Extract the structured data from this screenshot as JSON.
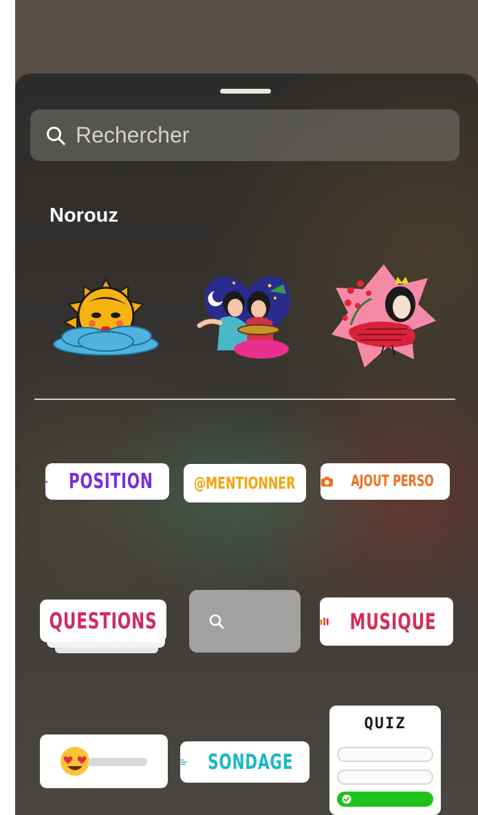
{
  "search": {
    "placeholder": "Rechercher"
  },
  "section": {
    "title": "Norouz"
  },
  "stickers": [
    {
      "name": "sun-in-clouds"
    },
    {
      "name": "musician-couple"
    },
    {
      "name": "woman-with-bird"
    }
  ],
  "chips": {
    "position": "POSITION",
    "mention": "@MENTIONNER",
    "ajout_perso": "AJOUT PERSO",
    "questions": "QUESTIONS",
    "musique": "MUSIQUE",
    "sondage": "SONDAGE",
    "quiz": "QUIZ"
  },
  "icons": {
    "search": "search-icon",
    "location": "location-pin-icon",
    "camera": "camera-icon",
    "music": "music-bars-icon",
    "poll": "poll-lines-icon",
    "emoji": "heart-eyes-emoji-icon",
    "check": "check-icon"
  },
  "colors": {
    "position": "#7b2fd6",
    "mention": "#f2a614",
    "ajout_perso": "#f06d1c",
    "questions": "#d02a68",
    "musique": "#d52d56",
    "sondage": "#19b7c6",
    "quiz_correct": "#1fc21b"
  }
}
